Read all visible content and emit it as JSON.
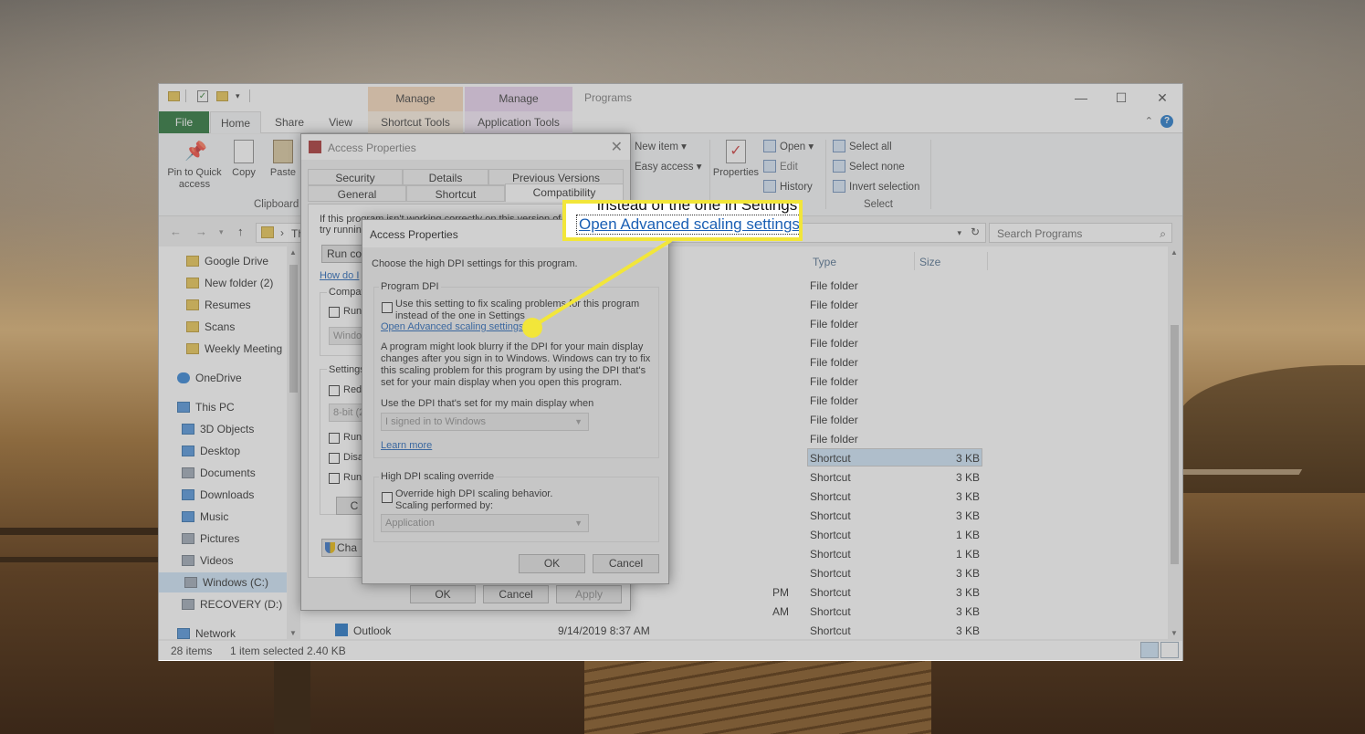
{
  "explorer": {
    "title": "Programs",
    "context_tabs": [
      {
        "group": "Manage",
        "tab": "Shortcut Tools",
        "color": "#f6d7b8"
      },
      {
        "group": "Manage",
        "tab": "Application Tools",
        "color": "#e8d2ee"
      }
    ],
    "ribbon_tabs": [
      "File",
      "Home",
      "Share",
      "View"
    ],
    "clipboard": {
      "pin": "Pin to Quick access",
      "copy": "Copy",
      "paste": "Paste",
      "group": "Clipboard"
    },
    "new_group": {
      "new_item": "New item",
      "easy_access": "Easy access"
    },
    "open_group": {
      "properties": "Properties",
      "open": "Open",
      "edit": "Edit",
      "history": "History"
    },
    "select_group": {
      "select_all": "Select all",
      "select_none": "Select none",
      "invert": "Invert selection",
      "label": "Select"
    },
    "address_partial": "Th",
    "search_placeholder": "Search Programs",
    "nav_items": [
      {
        "label": "Google Drive",
        "icon": "folder-yellow"
      },
      {
        "label": "New folder (2)",
        "icon": "folder-yellow"
      },
      {
        "label": "Resumes",
        "icon": "folder-yellow"
      },
      {
        "label": "Scans",
        "icon": "folder-yellow"
      },
      {
        "label": "Weekly Meeting",
        "icon": "folder-yellow"
      },
      {
        "label": "OneDrive",
        "icon": "cloud"
      },
      {
        "label": "This PC",
        "icon": "computer"
      },
      {
        "label": "3D Objects",
        "icon": "folder-blue"
      },
      {
        "label": "Desktop",
        "icon": "folder-blue"
      },
      {
        "label": "Documents",
        "icon": "folder-gray"
      },
      {
        "label": "Downloads",
        "icon": "folder-blue"
      },
      {
        "label": "Music",
        "icon": "folder-blue"
      },
      {
        "label": "Pictures",
        "icon": "folder-gray"
      },
      {
        "label": "Videos",
        "icon": "folder-gray"
      },
      {
        "label": "Windows (C:)",
        "icon": "drive"
      },
      {
        "label": "RECOVERY (D:)",
        "icon": "drive"
      },
      {
        "label": "Network",
        "icon": "network"
      }
    ],
    "columns": {
      "type": "Type",
      "size": "Size"
    },
    "rows": [
      {
        "date": "",
        "type": "File folder",
        "size": ""
      },
      {
        "date": "",
        "type": "File folder",
        "size": ""
      },
      {
        "date": "",
        "type": "File folder",
        "size": ""
      },
      {
        "date": "",
        "type": "File folder",
        "size": ""
      },
      {
        "date": "",
        "type": "File folder",
        "size": ""
      },
      {
        "date": "",
        "type": "File folder",
        "size": ""
      },
      {
        "date": "",
        "type": "File folder",
        "size": ""
      },
      {
        "date": "",
        "type": "File folder",
        "size": ""
      },
      {
        "date": "",
        "type": "File folder",
        "size": ""
      },
      {
        "date": "",
        "type": "Shortcut",
        "size": "3 KB"
      },
      {
        "date": "",
        "type": "Shortcut",
        "size": "3 KB"
      },
      {
        "date": "",
        "type": "Shortcut",
        "size": "3 KB"
      },
      {
        "date": "",
        "type": "Shortcut",
        "size": "3 KB"
      },
      {
        "date": "",
        "type": "Shortcut",
        "size": "1 KB"
      },
      {
        "date": "",
        "type": "Shortcut",
        "size": "1 KB"
      },
      {
        "date": "",
        "type": "Shortcut",
        "size": "3 KB"
      },
      {
        "date": "PM",
        "type": "Shortcut",
        "size": "3 KB"
      },
      {
        "date": "AM",
        "type": "Shortcut",
        "size": "3 KB"
      },
      {
        "date": "9/14/2019 8:37 AM",
        "type": "Shortcut",
        "size": "3 KB"
      }
    ],
    "last_row_name": "Outlook",
    "status": {
      "items": "28 items",
      "selected": "1 item selected  2.40 KB"
    }
  },
  "outer_dialog": {
    "title": "Access Properties",
    "tabs_row1": [
      "Security",
      "Details",
      "Previous Versions"
    ],
    "tabs_row2": [
      "General",
      "Shortcut",
      "Compatibility"
    ],
    "intro1": "If this program isn't working correctly on this version of W",
    "intro2": "try running",
    "run_btn": "Run co",
    "how_link": "How do I",
    "compat_label": "Compati",
    "run_label": "Run",
    "windows_sel": "Windo",
    "settings_label": "Settings",
    "reduced": "Redu",
    "bit": "8-bit (2",
    "run2": "Run",
    "disable": "Disa",
    "run3": "Run",
    "change_btn": "C",
    "change_all": "Cha",
    "ok": "OK",
    "cancel": "Cancel",
    "apply": "Apply"
  },
  "dpi_dialog": {
    "title": "Access Properties",
    "intro": "Choose the high DPI settings for this program.",
    "program_dpi_label": "Program DPI",
    "use_setting": "Use this setting to fix scaling problems for this program",
    "use_setting2": "instead of the one in Settings",
    "advanced_link": "Open Advanced scaling settings",
    "blurry_text": "A program might look blurry if the DPI for your main display changes after you sign in to Windows. Windows can try to fix this scaling problem for this program by using the DPI that's set for your main display when you open this program.",
    "use_dpi_label": "Use the DPI that's set for my main display when",
    "signed_in": "I signed in to Windows",
    "learn_more": "Learn more",
    "override_label": "High DPI scaling override",
    "override_text": "Override high DPI scaling behavior.",
    "scaling_by": "Scaling performed by:",
    "application": "Application",
    "ok": "OK",
    "cancel": "Cancel"
  },
  "callout": {
    "cut_text": "instead of the one in Settings",
    "link_text": "Open Advanced scaling settings",
    "color": "#f2e63a"
  }
}
